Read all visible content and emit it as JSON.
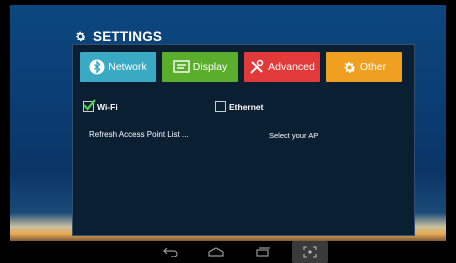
{
  "header": {
    "title": "SETTINGS",
    "icon": "gear-icon"
  },
  "tabs": [
    {
      "label": "Network",
      "color": "#39a9c4",
      "icon": "bluetooth-icon"
    },
    {
      "label": "Display",
      "color": "#5aae2c",
      "icon": "display-icon"
    },
    {
      "label": "Advanced",
      "color": "#e23a3a",
      "icon": "tools-icon"
    },
    {
      "label": "Other",
      "color": "#f0a020",
      "icon": "gear-icon"
    }
  ],
  "options": {
    "wifi": {
      "label": "Wi-Fi",
      "checked": true
    },
    "ethernet": {
      "label": "Ethernet",
      "checked": false
    }
  },
  "access_point": {
    "refresh_label": "Refresh Access Point List ...",
    "select_label": "Select your AP"
  },
  "navbar": [
    "back-icon",
    "home-icon",
    "recent-apps-icon",
    "screenshot-icon"
  ]
}
